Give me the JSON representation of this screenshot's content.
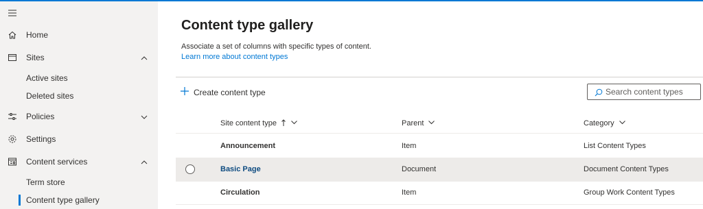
{
  "sidebar": {
    "menu_icon": "hamburger-icon",
    "items": [
      {
        "label": "Home",
        "icon": "home-icon"
      },
      {
        "label": "Sites",
        "icon": "window-icon",
        "expanded": true
      },
      {
        "label": "Active sites"
      },
      {
        "label": "Deleted sites"
      },
      {
        "label": "Policies",
        "icon": "sliders-icon",
        "expanded": false
      },
      {
        "label": "Settings",
        "icon": "gear-icon"
      },
      {
        "label": "Content services",
        "icon": "content-services-icon",
        "expanded": true
      },
      {
        "label": "Term store"
      },
      {
        "label": "Content type gallery",
        "selected": true
      }
    ]
  },
  "main": {
    "title": "Content type gallery",
    "description": "Associate a set of columns with specific types of content.",
    "learn_more": "Learn more about content types",
    "create_label": "Create content type",
    "search_placeholder": "Search content types"
  },
  "table": {
    "columns": [
      "Site content type",
      "Parent",
      "Category"
    ],
    "sort": {
      "column": "Site content type",
      "direction": "ascending"
    },
    "rows": [
      {
        "name": "Announcement",
        "parent": "Item",
        "category": "List Content Types"
      },
      {
        "name": "Basic Page",
        "parent": "Document",
        "category": "Document Content Types",
        "hovered": true
      },
      {
        "name": "Circulation",
        "parent": "Item",
        "category": "Group Work Content Types"
      }
    ]
  },
  "colors": {
    "accent": "#0078d4",
    "link": "#0f4c81",
    "sidebar_bg": "#f3f2f1",
    "row_hover": "#edebe9"
  }
}
